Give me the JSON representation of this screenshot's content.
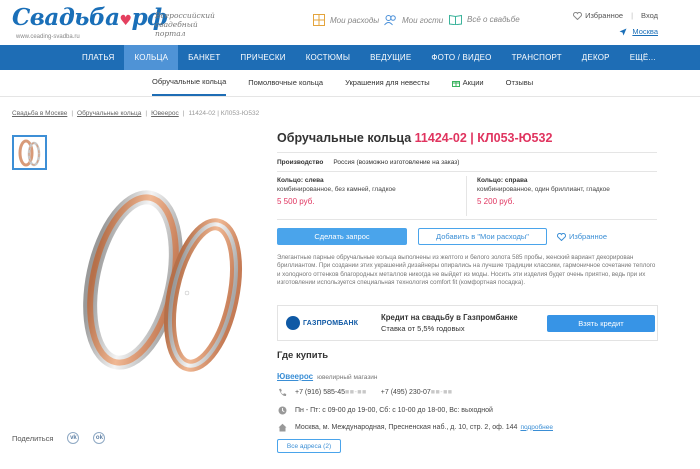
{
  "header": {
    "logo_text": "Свадьба",
    "logo_tld": "рф",
    "logo_url": "www.ceading-svadba.ru",
    "tagline": "Всероссийский свадебный портал",
    "tools": [
      {
        "label": "Мои расходы",
        "icon": "calculator-icon"
      },
      {
        "label": "Мои гости",
        "icon": "guests-icon"
      },
      {
        "label": "Всё о свадьбе",
        "icon": "book-icon"
      }
    ],
    "favorites_label": "Избранное",
    "login_label": "Вход",
    "city": "Москва"
  },
  "main_nav": [
    "ПЛАТЬЯ",
    "КОЛЬЦА",
    "БАНКЕТ",
    "ПРИЧЕСКИ",
    "КОСТЮМЫ",
    "ВЕДУЩИЕ",
    "ФОТО / ВИДЕО",
    "ТРАНСПОРТ",
    "ДЕКОР",
    "ЕЩЁ..."
  ],
  "sub_nav": [
    "Обручальные кольца",
    "Помолвочные кольца",
    "Украшения для невесты",
    "Акции",
    "Отзывы"
  ],
  "breadcrumb": [
    "Свадьба в Москве",
    "Обручальные кольца",
    "Ювеерос",
    "11424-02 | КЛ053-Ю532"
  ],
  "product": {
    "title": "Обручальные кольца",
    "sku": "11424-02 | КЛ053-Ю532",
    "producer_label": "Производство",
    "producer_value": "Россия (возможно изготовление на заказ)",
    "ring_left": {
      "heading": "Кольцо: слева",
      "description": "комбинированное, без камней, гладкое",
      "price": "5 500 руб."
    },
    "ring_right": {
      "heading": "Кольцо: справа",
      "description": "комбинированное, один бриллиант, гладкое",
      "price": "5 200 руб."
    },
    "request_button": "Сделать запрос",
    "expenses_button": "Добавить в \"Мои расходы\"",
    "favorite_label": "Избранное",
    "description": "Элегантные парные обручальные кольца выполнены из желтого и белого золота 585 пробы, женский вариант декорирован бриллиантом. При создании этих украшений дизайнеры опирались на лучшие традиции классики, гармоничное сочетание теплого и холодного оттенков благородных металлов никогда не выйдет из моды. Носить эти изделия будет очень приятно, ведь при их изготовлении используется специальная технология comfort fit (комфортная посадка)."
  },
  "bank": {
    "logo_text": "ГАЗПРОМБАНК",
    "title": "Кредит на свадьбу в Газпромбанке",
    "rate": "Ставка от 5,5% годовых",
    "button": "Взять кредит"
  },
  "where_to_buy": {
    "heading": "Где купить",
    "shop_name": "Ювеерос",
    "shop_type": "ювелирный магазин",
    "phone1": "+7 (916) 585-45",
    "phone1_hidden": "■■-■■",
    "phone2": "+7 (495) 230-07",
    "phone2_hidden": "■■-■■",
    "hours": "Пн - Пт: с 09-00 до 19-00, Сб: с 10-00 до 18-00, Вс: выходной",
    "address": "Москва, м. Международная, Пресненская наб., д. 10, стр. 2, оф. 144",
    "address_more": "подробнее",
    "all_addresses_button": "Все адреса (2)"
  },
  "share": {
    "label": "Поделиться",
    "networks": [
      {
        "short": "vk",
        "icon": "vk-icon"
      },
      {
        "short": "ok",
        "icon": "odnoklassniki-icon"
      }
    ]
  },
  "colors": {
    "brand_blue": "#1e6db5",
    "accent_pink": "#e0345f",
    "button_blue": "#4aa4eb"
  }
}
